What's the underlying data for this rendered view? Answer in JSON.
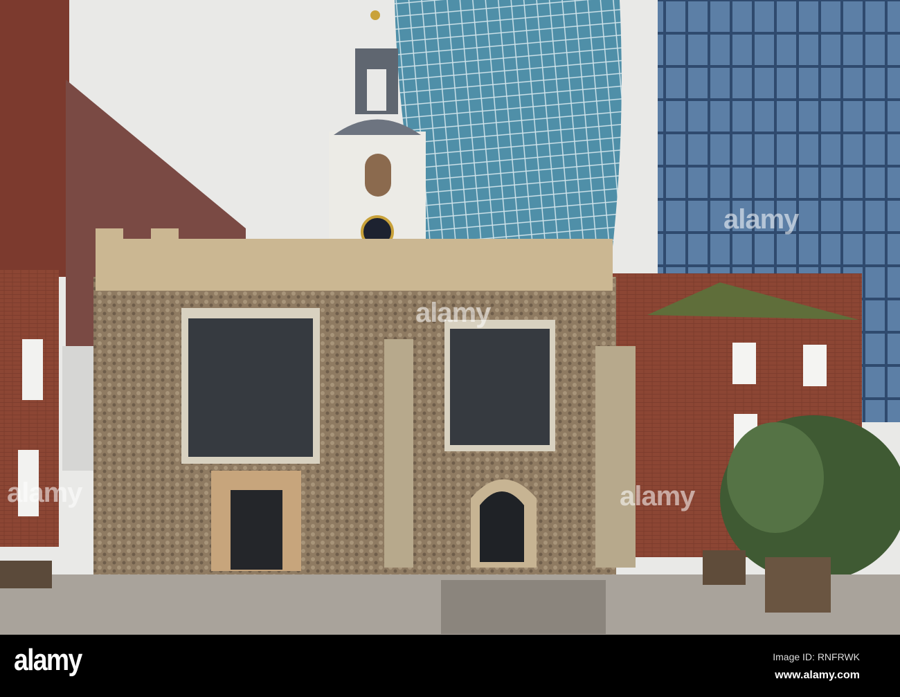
{
  "photo": {
    "subject": "stone church with bell tower in front of glass skyscrapers"
  },
  "watermark": {
    "text": "alamy"
  },
  "footer": {
    "logo": "alamy",
    "image_id": "Image ID: RNFRWK",
    "url": "www.alamy.com"
  }
}
